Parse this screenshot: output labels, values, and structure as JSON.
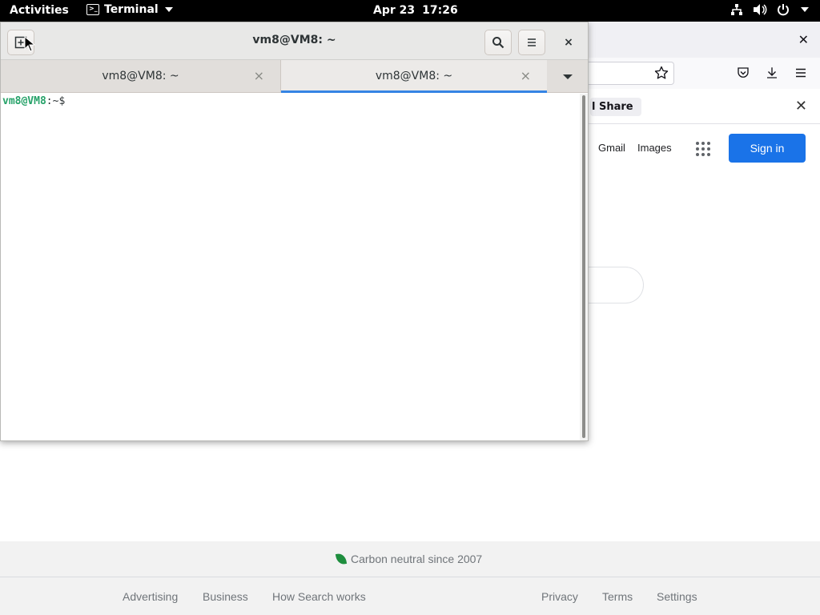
{
  "topbar": {
    "activities": "Activities",
    "app_name": "Terminal",
    "date": "Apr 23",
    "time": "17:26"
  },
  "terminal": {
    "title": "vm8@VM8: ~",
    "tabs": [
      {
        "label": "vm8@VM8: ~",
        "active": false
      },
      {
        "label": "vm8@VM8: ~",
        "active": true
      }
    ],
    "prompt_user": "vm8@VM8",
    "prompt_sep": ":",
    "prompt_path": "~$",
    "close_glyph": "×",
    "tab_close_glyph": "×"
  },
  "firefox": {
    "close_glyph": "✕",
    "notification_text": "l Share",
    "notification_close": "✕"
  },
  "google": {
    "gmail": "Gmail",
    "images": "Images",
    "sign_in": "Sign in",
    "carbon": "Carbon neutral since 2007",
    "footer_left": [
      "Advertising",
      "Business",
      "How Search works"
    ],
    "footer_right": [
      "Privacy",
      "Terms",
      "Settings"
    ]
  },
  "colors": {
    "accent": "#3584e4",
    "prompt_green": "#26a269",
    "google_blue": "#1a73e8"
  }
}
